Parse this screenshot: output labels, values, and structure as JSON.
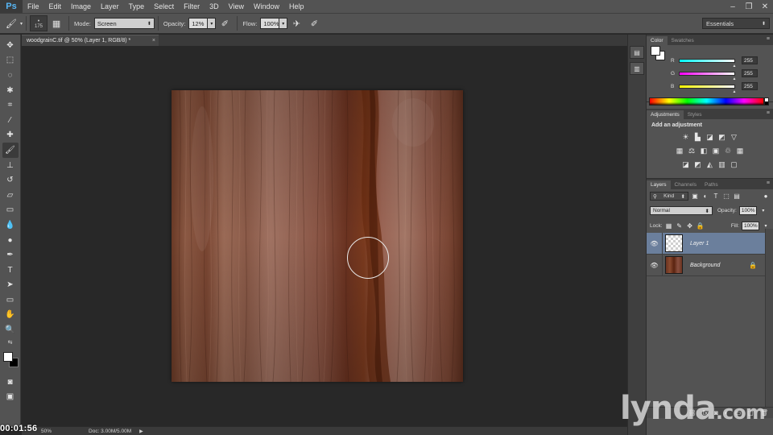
{
  "app": {
    "logo": "Ps",
    "menu": [
      "File",
      "Edit",
      "Image",
      "Layer",
      "Type",
      "Select",
      "Filter",
      "3D",
      "View",
      "Window",
      "Help"
    ],
    "window_controls": [
      "–",
      "❐",
      "✕"
    ]
  },
  "options": {
    "brush_size": "175",
    "mode_label": "Mode:",
    "mode_value": "Screen",
    "opacity_label": "Opacity:",
    "opacity_value": "12%",
    "flow_label": "Flow:",
    "flow_value": "100%",
    "workspace": "Essentials"
  },
  "document": {
    "tab_title": "woodgrainC.tif @ 50% (Layer 1, RGB/8) *",
    "close": "×"
  },
  "status": {
    "timecode": "00:01:56",
    "zoom": "50%",
    "doc_size": "Doc: 3.00M/5.00M"
  },
  "color_panel": {
    "tabs": [
      "Color",
      "Swatches"
    ],
    "channels": [
      {
        "label": "R",
        "value": "255"
      },
      {
        "label": "G",
        "value": "255"
      },
      {
        "label": "B",
        "value": "255"
      }
    ],
    "colors": {
      "r_track": "#ff0000",
      "g_track": "#00ff00",
      "b_track": "#0000ff"
    }
  },
  "adjustments_panel": {
    "tabs": [
      "Adjustments",
      "Styles"
    ],
    "title": "Add an adjustment"
  },
  "layers_panel": {
    "tabs": [
      "Layers",
      "Channels",
      "Paths"
    ],
    "kind_filter": "Kind",
    "blend_mode": "Normal",
    "opacity_label": "Opacity:",
    "opacity_value": "100%",
    "lock_label": "Lock:",
    "fill_label": "Fill:",
    "fill_value": "100%",
    "layers": [
      {
        "name": "Layer 1",
        "selected": true,
        "locked": false
      },
      {
        "name": "Background",
        "selected": false,
        "locked": true
      }
    ]
  },
  "watermark": {
    "brand": "lynda",
    "suffix": ".com"
  },
  "ui_colors": {
    "chrome": "#535353",
    "canvas_bg": "#282828",
    "selection": "#6b7f9c",
    "ps_blue": "#57b6f5"
  }
}
